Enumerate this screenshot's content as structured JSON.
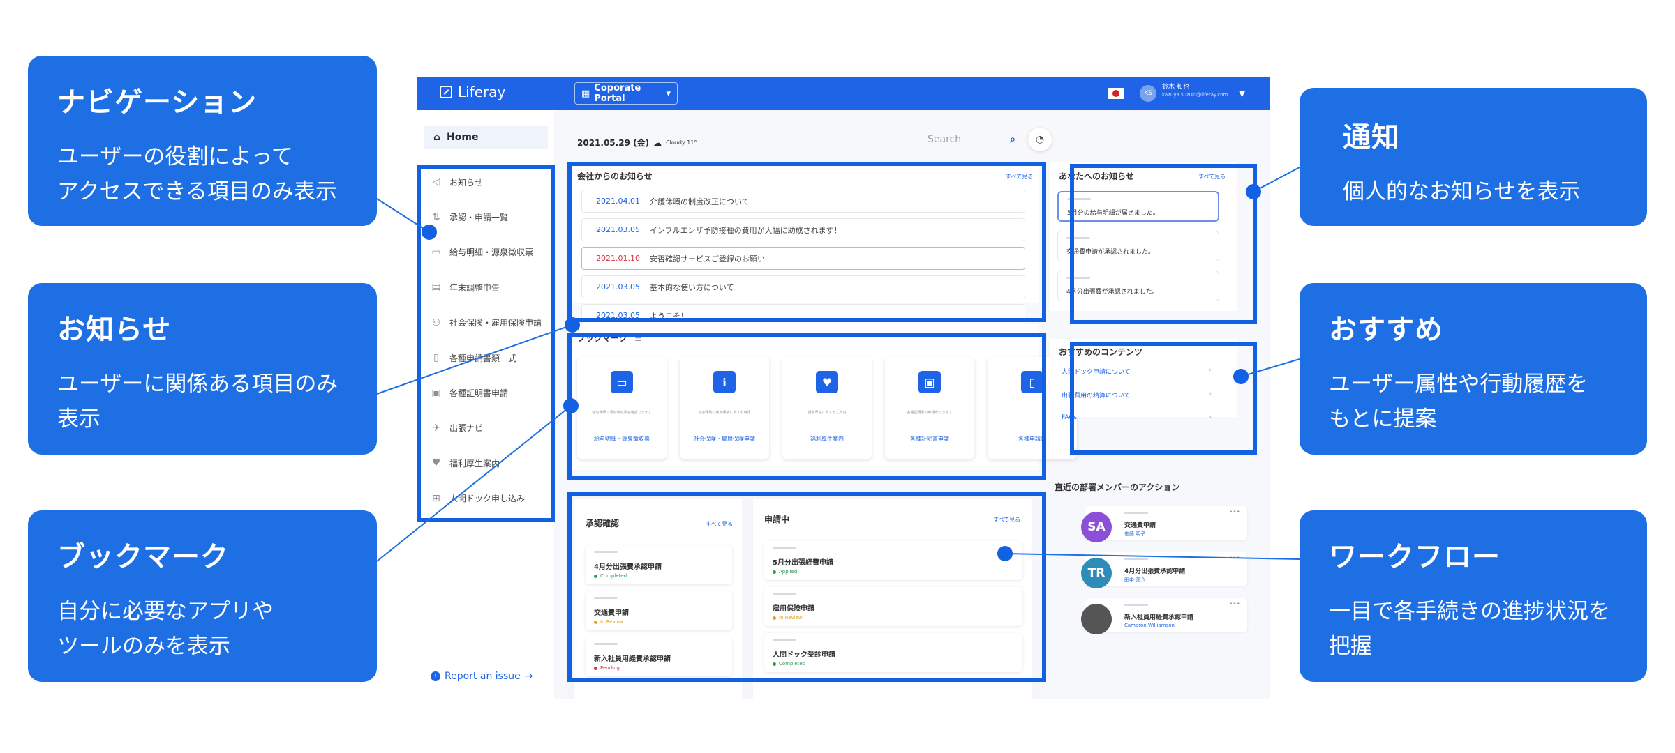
{
  "callouts": {
    "nav": {
      "title": "ナビゲーション",
      "body": "ユーザーの役割によって\nアクセスできる項目のみ表示"
    },
    "news": {
      "title": "お知らせ",
      "body": "ユーザーに関係ある項目のみ\n表示"
    },
    "bookmark": {
      "title": "ブックマーク",
      "body": "自分に必要なアプリや\nツールのみを表示"
    },
    "notify": {
      "title": "通知",
      "body": "個人的なお知らせを表示"
    },
    "recommend": {
      "title": "おすすめ",
      "body": "ユーザー属性や行動履歴を\nもとに提案"
    },
    "workflow": {
      "title": "ワークフロー",
      "body": "一目で各手続きの進捗状況を\n把握"
    }
  },
  "app": {
    "brand": "Liferay",
    "portal": "Coporate Portal",
    "user_name": "鈴木 和也",
    "user_email": "kazuya.suzuki@liferay.com",
    "user_initials": "KS",
    "brand_color": "#1f64e6",
    "accent_frame_color": "#1361e3"
  },
  "sidebar": {
    "home": "Home",
    "items": [
      {
        "label": "お知らせ",
        "icon": "megaphone-icon"
      },
      {
        "label": "承認・申請一覧",
        "icon": "sort-icon"
      },
      {
        "label": "給与明細・源泉徴収票",
        "icon": "card-icon"
      },
      {
        "label": "年末調整申告",
        "icon": "document-icon"
      },
      {
        "label": "社会保険・雇用保険申請",
        "icon": "people-icon"
      },
      {
        "label": "各種申請書類一式",
        "icon": "file-icon"
      },
      {
        "label": "各種証明書申請",
        "icon": "certificate-icon"
      },
      {
        "label": "出張ナビ",
        "icon": "plane-icon"
      },
      {
        "label": "福利厚生案内",
        "icon": "heart-icon"
      },
      {
        "label": "人間ドック申し込み",
        "icon": "medical-icon"
      }
    ],
    "report": "Report an issue"
  },
  "header": {
    "date": "2021.05.29 (金)",
    "weather": "Cloudy 11°",
    "search_placeholder": "Search"
  },
  "company_news": {
    "title": "会社からのお知らせ",
    "see_all": "すべて見る",
    "items": [
      {
        "date": "2021.04.01",
        "text": "介護休暇の制度改正について"
      },
      {
        "date": "2021.03.05",
        "text": "インフルエンザ予防接種の費用が大幅に助成されます！"
      },
      {
        "date": "2021.01.10",
        "text": "安否確認サービスご登録のお願い"
      },
      {
        "date": "2021.03.05",
        "text": "基本的な使い方について"
      },
      {
        "date": "2021.03.05",
        "text": "ようこそ！"
      }
    ]
  },
  "bookmarks": {
    "title": "ブックマーク",
    "items": [
      {
        "name": "給与明細・源泉徴収票",
        "desc": "給与明細・源泉徴収票を確認できます",
        "icon": "card-icon"
      },
      {
        "name": "社会保険・雇用保険申請",
        "desc": "社会保険・雇用保険に関する申請",
        "icon": "info-icon"
      },
      {
        "name": "福利厚生案内",
        "desc": "福利厚生に関するご案内",
        "icon": "heart-icon"
      },
      {
        "name": "各種証明書申請",
        "desc": "各種証明書の申請ができます",
        "icon": "certificate-icon"
      },
      {
        "name": "各種申請書",
        "desc": "",
        "icon": "file-icon"
      }
    ]
  },
  "approvals": {
    "title": "承認確認",
    "see_all": "すべて見る",
    "items": [
      {
        "title": "4月分出張費承認申請",
        "status": "Completed",
        "color": "#2e9c54"
      },
      {
        "title": "交通費申請",
        "status": "In Review",
        "color": "#e2a21b"
      },
      {
        "title": "新入社員用経費承認申請",
        "status": "Pending",
        "color": "#d8313d"
      }
    ]
  },
  "applying": {
    "title": "申請中",
    "see_all": "すべて見る",
    "items": [
      {
        "title": "5月分出張経費申請",
        "status": "Applied",
        "color": "#2e9c54"
      },
      {
        "title": "雇用保険申請",
        "status": "In Review",
        "color": "#e2a21b"
      },
      {
        "title": "人間ドック受診申請",
        "status": "Completed",
        "color": "#2e9c54"
      }
    ]
  },
  "your_notices": {
    "title": "あなたへのお知らせ",
    "see_all": "すべて見る",
    "items": [
      {
        "text": "5月分の給与明細が届きました。"
      },
      {
        "text": "交通費申請が承認されました。"
      },
      {
        "text": "4月分出張費が承認されました。"
      }
    ]
  },
  "recommended": {
    "title": "おすすめのコンテンツ",
    "items": [
      {
        "text": "人間ドック申請について"
      },
      {
        "text": "出張費用の精算について"
      },
      {
        "text": "FAQs"
      }
    ]
  },
  "activity": {
    "title": "直近の部署メンバーのアクション",
    "items": [
      {
        "initials": "SA",
        "color": "#8b4fd8",
        "title": "交通費申請",
        "user": "佐藤 明子"
      },
      {
        "initials": "TR",
        "color": "#2f8bb8",
        "title": "4月分出張費承認申請",
        "user": "田中 亮介"
      },
      {
        "initials": "",
        "color": "#555555",
        "title": "新入社員用経費承認申請",
        "user": "Cameron Williamson"
      }
    ]
  }
}
